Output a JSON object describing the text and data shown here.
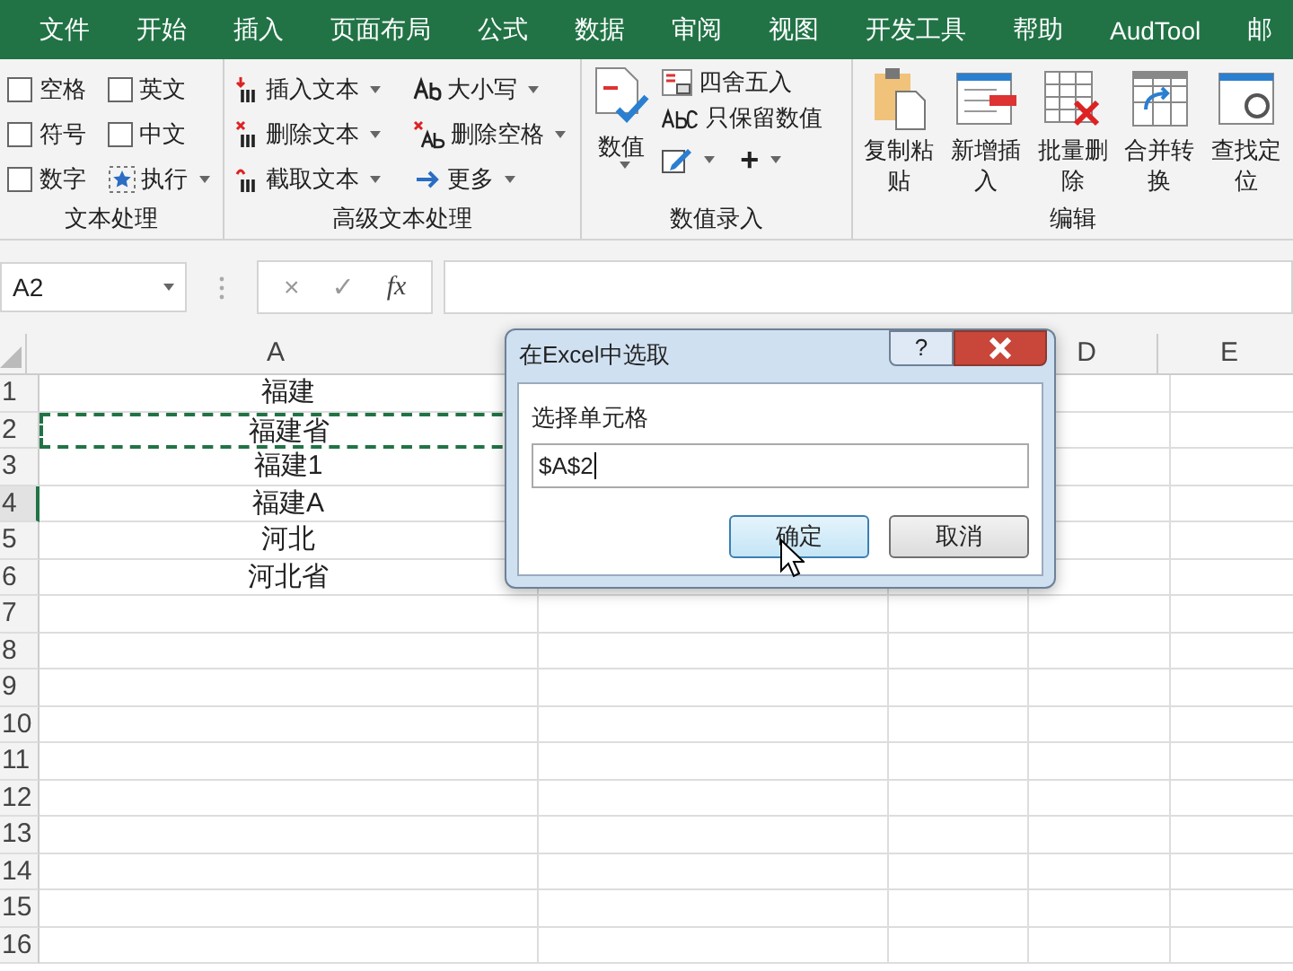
{
  "tabs": [
    {
      "label": "文件"
    },
    {
      "label": "开始"
    },
    {
      "label": "插入"
    },
    {
      "label": "页面布局"
    },
    {
      "label": "公式"
    },
    {
      "label": "数据"
    },
    {
      "label": "审阅"
    },
    {
      "label": "视图"
    },
    {
      "label": "开发工具"
    },
    {
      "label": "帮助"
    },
    {
      "label": "AudTool"
    },
    {
      "label": "邮"
    }
  ],
  "ribbon": {
    "text_group": {
      "label": "文本处理",
      "checkboxes": [
        {
          "label": "空格",
          "checked": false
        },
        {
          "label": "英文",
          "checked": false
        },
        {
          "label": "符号",
          "checked": false
        },
        {
          "label": "中文",
          "checked": false
        },
        {
          "label": "数字",
          "checked": false
        }
      ],
      "run_button": "执行"
    },
    "advanced_group": {
      "label": "高级文本处理",
      "buttons": [
        "插入文本",
        "删除文本",
        "截取文本",
        "大小写",
        "删除空格",
        "更多"
      ]
    },
    "number_group": {
      "label": "数值录入",
      "large_button": "数值",
      "buttons": [
        "四舍五入",
        "只保留数值"
      ],
      "plus": "+"
    },
    "edit_group": {
      "label": "编辑",
      "buttons": [
        "复制粘贴",
        "新增插入",
        "批量删除",
        "合并转换",
        "查找定位"
      ]
    }
  },
  "formula_bar": {
    "name_box": "A2",
    "cancel": "×",
    "enter": "✓",
    "function": "fx"
  },
  "sheet": {
    "columns": [
      "A",
      "D",
      "E"
    ],
    "rows": [
      {
        "number": "1",
        "value": "福建",
        "marquee": false,
        "active": false
      },
      {
        "number": "2",
        "value": "福建省",
        "marquee": true,
        "active": false
      },
      {
        "number": "3",
        "value": "福建1",
        "marquee": false,
        "active": false
      },
      {
        "number": "4",
        "value": "福建A",
        "marquee": false,
        "active": true
      },
      {
        "number": "5",
        "value": "河北",
        "marquee": false,
        "active": false
      },
      {
        "number": "6",
        "value": "河北省",
        "marquee": false,
        "active": false
      },
      {
        "number": "7",
        "value": "",
        "marquee": false,
        "active": false
      },
      {
        "number": "8",
        "value": "",
        "marquee": false,
        "active": false
      },
      {
        "number": "9",
        "value": "",
        "marquee": false,
        "active": false
      },
      {
        "number": "10",
        "value": "",
        "marquee": false,
        "active": false
      },
      {
        "number": "11",
        "value": "",
        "marquee": false,
        "active": false
      },
      {
        "number": "12",
        "value": "",
        "marquee": false,
        "active": false
      },
      {
        "number": "13",
        "value": "",
        "marquee": false,
        "active": false
      },
      {
        "number": "14",
        "value": "",
        "marquee": false,
        "active": false
      },
      {
        "number": "15",
        "value": "",
        "marquee": false,
        "active": false
      },
      {
        "number": "16",
        "value": "",
        "marquee": false,
        "active": false
      }
    ]
  },
  "dialog": {
    "title": "在Excel中选取",
    "help": "?",
    "field_label": "选择单元格",
    "value": "$A$2",
    "buttons": [
      {
        "label": "确定",
        "hovered": true
      },
      {
        "label": "取消",
        "hovered": false
      }
    ]
  }
}
